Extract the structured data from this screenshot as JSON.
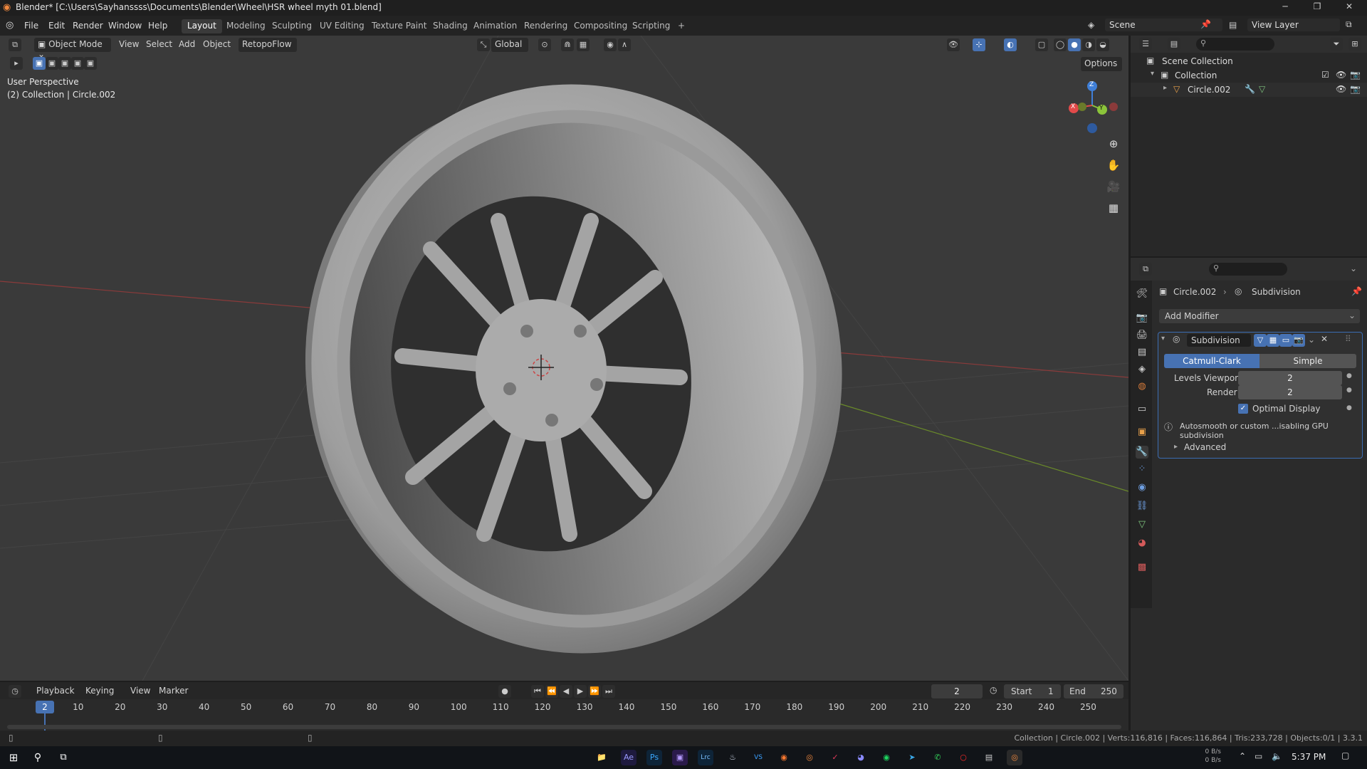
{
  "window": {
    "title": "Blender* [C:\\Users\\Sayhanssss\\Documents\\Blender\\Wheel\\HSR wheel myth 01.blend]",
    "controls": [
      "─",
      "❐",
      "✕"
    ]
  },
  "menu": {
    "items": [
      "File",
      "Edit",
      "Render",
      "Window",
      "Help"
    ],
    "workspaces": [
      "Layout",
      "Modeling",
      "Sculpting",
      "UV Editing",
      "Texture Paint",
      "Shading",
      "Animation",
      "Rendering",
      "Compositing",
      "Scripting"
    ],
    "active_workspace": "Layout",
    "add_tab": "+",
    "scene": "Scene",
    "view_layer": "View Layer"
  },
  "viewport_header": {
    "mode": "Object Mode",
    "menus": [
      "View",
      "Select",
      "Add",
      "Object"
    ],
    "addon": "RetopoFlow",
    "transform_orientation": "Global",
    "options": "Options"
  },
  "viewport": {
    "perspective": "User Perspective",
    "collection_info": "(2) Collection | Circle.002",
    "gizmo_axes": [
      "X",
      "Y",
      "Z"
    ]
  },
  "outliner": {
    "items": [
      {
        "label": "Scene Collection",
        "level": 0
      },
      {
        "label": "Collection",
        "level": 1
      },
      {
        "label": "Circle.002",
        "level": 2
      }
    ]
  },
  "properties": {
    "breadcrumb_object": "Circle.002",
    "breadcrumb_modifier": "Subdivision",
    "add_modifier": "Add Modifier",
    "modifier": {
      "name": "Subdivision",
      "mode_catmull": "Catmull-Clark",
      "mode_simple": "Simple",
      "active_mode": "Catmull-Clark",
      "levels_viewport_label": "Levels Viewport",
      "levels_viewport": "2",
      "render_label": "Render",
      "render": "2",
      "optimal_display_label": "Optimal Display",
      "optimal_display": true,
      "info": "Autosmooth or custom ...isabling GPU subdivision",
      "advanced": "Advanced"
    }
  },
  "timeline": {
    "menus": [
      "Playback",
      "Keying",
      "View",
      "Marker"
    ],
    "current_frame": "2",
    "start_label": "Start",
    "start": "1",
    "end_label": "End",
    "end": "250",
    "ticks": [
      "10",
      "20",
      "30",
      "40",
      "50",
      "60",
      "70",
      "80",
      "90",
      "100",
      "110",
      "120",
      "130",
      "140",
      "150",
      "160",
      "170",
      "180",
      "190",
      "200",
      "210",
      "220",
      "230",
      "240",
      "250"
    ]
  },
  "statusbar": {
    "stats": "Collection | Circle.002 | Verts:116,816 | Faces:116,864 | Tris:233,728 | Objects:0/1 | 3.3.1"
  },
  "taskbar": {
    "clock": "5:37 PM",
    "net_rate_up": "0 B/s",
    "net_rate_down": "0 B/s",
    "apps": [
      "Ae",
      "Ps",
      "Lrc",
      "VS",
      "Blender"
    ]
  },
  "colors": {
    "accent": "#4772b3",
    "axis_x": "#e24a4a",
    "axis_y": "#8bc43a",
    "axis_z": "#3f7fd8",
    "viewport_bg": "#3a3a3a"
  }
}
